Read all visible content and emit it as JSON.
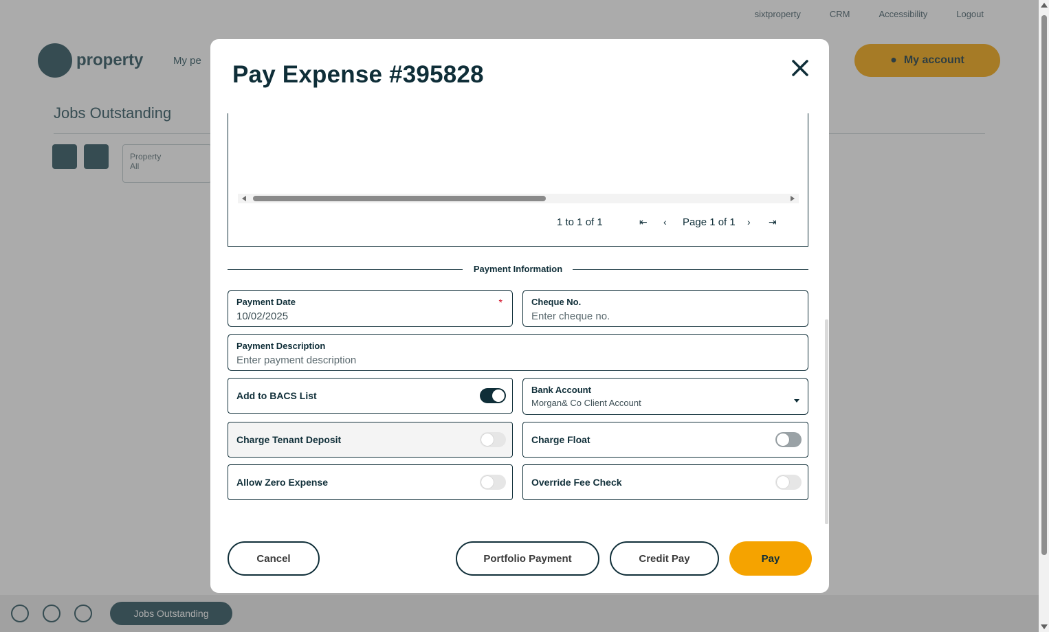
{
  "background": {
    "top_links": [
      "sixtproperty",
      "CRM",
      "Accessibility",
      "Logout"
    ],
    "logo_text": "property",
    "nav_text": "My pe",
    "account_button": "My account",
    "page_title": "Jobs Outstanding",
    "filter_label": "Property",
    "filter_value": "All",
    "footer_pill": "Jobs Outstanding"
  },
  "modal": {
    "title": "Pay Expense #395828",
    "close_icon": "close-icon",
    "grid": {
      "row_count_text": "1 to 1 of 1",
      "page_text": "Page 1 of 1",
      "first_icon": "⇤",
      "prev_icon": "‹",
      "next_icon": "›",
      "last_icon": "⇥"
    },
    "section_label": "Payment Information",
    "fields": {
      "payment_date": {
        "label": "Payment Date",
        "value": "10/02/2025",
        "required_mark": "*"
      },
      "cheque_no": {
        "label": "Cheque No.",
        "placeholder": "Enter cheque no."
      },
      "payment_description": {
        "label": "Payment Description",
        "placeholder": "Enter payment description"
      },
      "bank_account": {
        "label": "Bank Account",
        "value": "Morgan& Co Client Account"
      }
    },
    "toggles": {
      "add_to_bacs": {
        "label": "Add to BACS List",
        "on": true
      },
      "charge_tenant_deposit": {
        "label": "Charge Tenant Deposit",
        "on": false,
        "disabled": true
      },
      "charge_float": {
        "label": "Charge Float",
        "on": false,
        "disabled": true
      },
      "allow_zero_expense": {
        "label": "Allow Zero Expense",
        "on": false
      },
      "override_fee_check": {
        "label": "Override Fee Check",
        "on": false
      }
    },
    "buttons": {
      "cancel": "Cancel",
      "portfolio_payment": "Portfolio Payment",
      "credit_pay": "Credit Pay",
      "pay": "Pay"
    }
  },
  "colors": {
    "primary_dark": "#0f2e38",
    "accent": "#f5a300"
  }
}
